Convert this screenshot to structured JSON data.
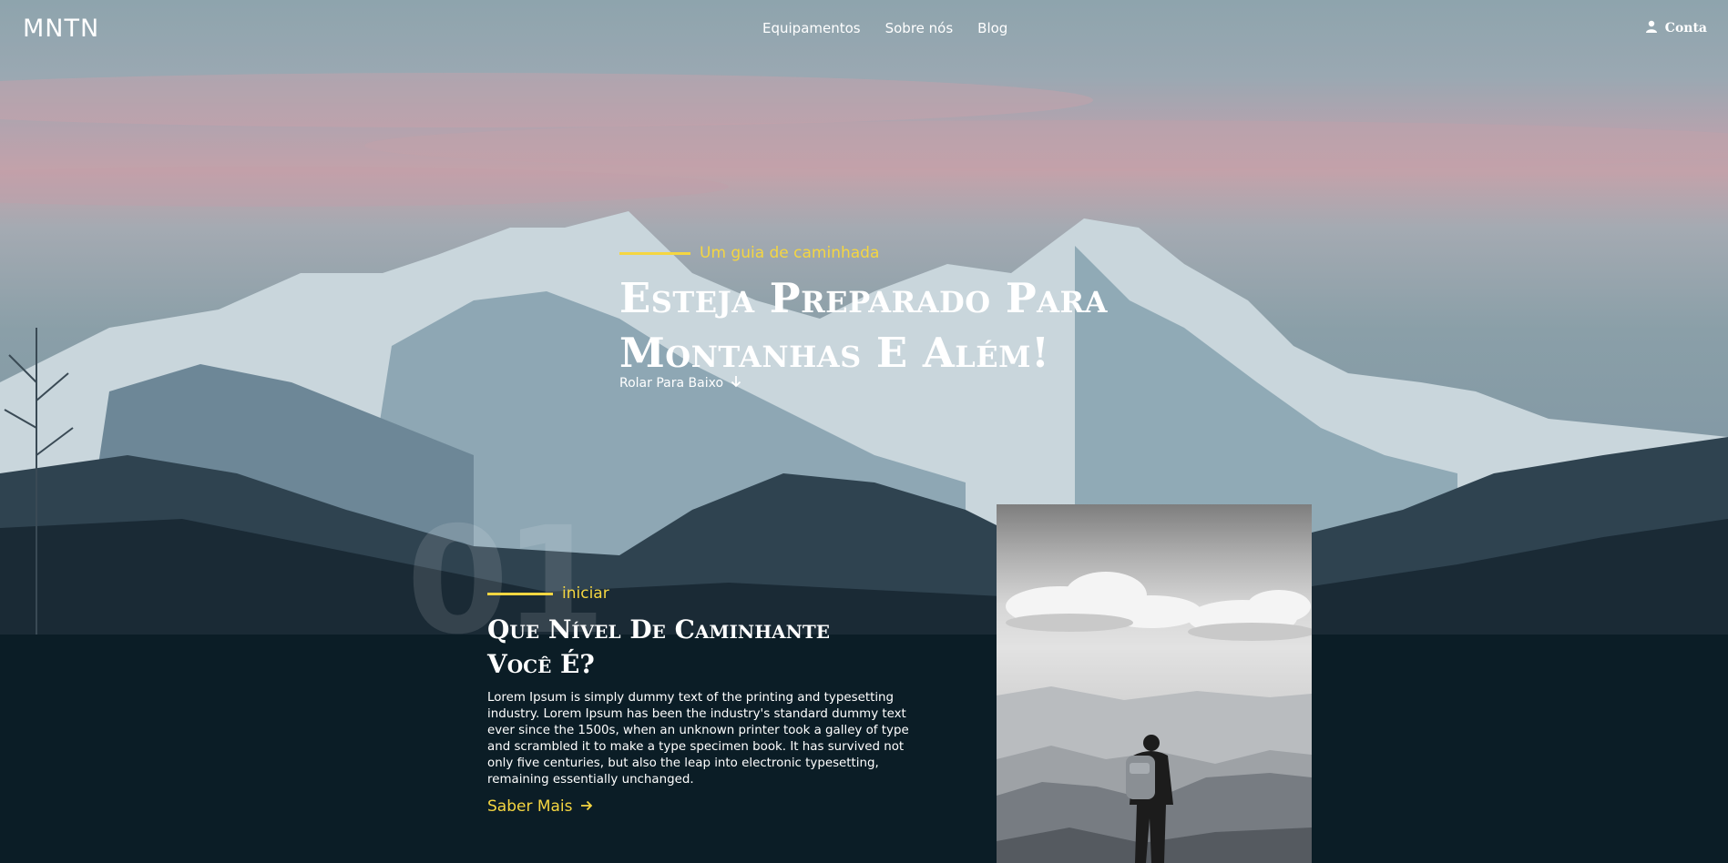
{
  "brand": {
    "logo": "MNTN"
  },
  "nav": {
    "items": [
      {
        "label": "Equipamentos"
      },
      {
        "label": "Sobre nós"
      },
      {
        "label": "Blog"
      }
    ],
    "account": {
      "label": "Conta",
      "icon": "user-icon"
    }
  },
  "hero": {
    "kicker": "Um guia de caminhada",
    "title": "Esteja Preparado Para Montanhas E Além!",
    "scroll_label": "Rolar Para Baixo",
    "scroll_icon": "arrow-down-icon"
  },
  "section": {
    "number": "01",
    "kicker": "iniciar",
    "title": "Que Nível De Caminhante Você É?",
    "body": "Lorem Ipsum is simply dummy text of the printing and typesetting industry. Lorem Ipsum has been the industry's standard dummy text ever since the 1500s, when an unknown printer took a galley of type and scrambled it to make a type specimen book. It has survived not only five centuries, but also the leap into electronic typesetting, remaining essentially unchanged.",
    "link_label": "Saber Mais",
    "link_icon": "arrow-right-icon"
  },
  "colors": {
    "accent": "#f5d641",
    "background": "#0b1d26"
  }
}
